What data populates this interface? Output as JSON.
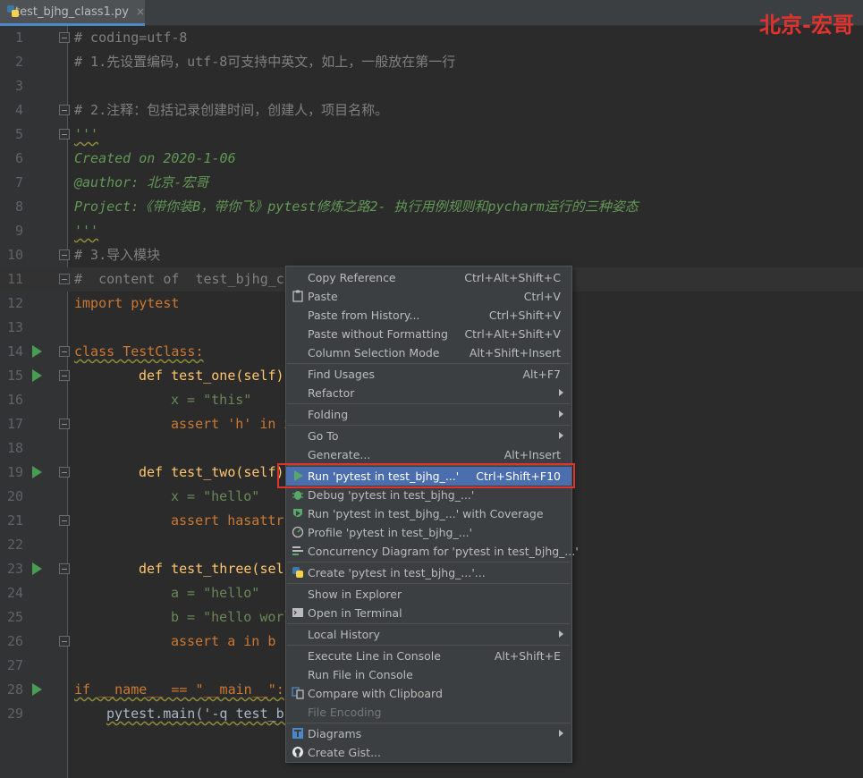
{
  "tab": {
    "filename": "test_bjhg_class1.py",
    "close": "×"
  },
  "watermark": "北京-宏哥",
  "code_lines": [
    {
      "n": "1",
      "text": "# coding=utf-8"
    },
    {
      "n": "2",
      "text": "# 1.先设置编码，utf-8可支持中英文，如上，一般放在第一行"
    },
    {
      "n": "3",
      "text": ""
    },
    {
      "n": "4",
      "text": "# 2.注释：包括记录创建时间，创建人，项目名称。"
    },
    {
      "n": "5",
      "text": "'''"
    },
    {
      "n": "6",
      "text": "Created on 2020-1-06"
    },
    {
      "n": "7",
      "text": "@author: 北京-宏哥"
    },
    {
      "n": "8",
      "text": "Project:《带你装B，带你飞》pytest修炼之路2- 执行用例规则和pycharm运行的三种姿态"
    },
    {
      "n": "9",
      "text": "'''"
    },
    {
      "n": "10",
      "text": "# 3.导入模块"
    },
    {
      "n": "11",
      "text": "#  content of  test_bjhg_c"
    },
    {
      "n": "12",
      "text": "import pytest"
    },
    {
      "n": "13",
      "text": ""
    },
    {
      "n": "14",
      "text": "class TestClass:"
    },
    {
      "n": "15",
      "text": "def test_one(self)"
    },
    {
      "n": "16",
      "text": "x = \"this\""
    },
    {
      "n": "17",
      "text": "assert 'h' in x"
    },
    {
      "n": "18",
      "text": ""
    },
    {
      "n": "19",
      "text": "def test_two(self)"
    },
    {
      "n": "20",
      "text": "x = \"hello\""
    },
    {
      "n": "21",
      "text": "assert hasattr"
    },
    {
      "n": "22",
      "text": ""
    },
    {
      "n": "23",
      "text": "def test_three(self"
    },
    {
      "n": "24",
      "text": "a = \"hello\""
    },
    {
      "n": "25",
      "text": "b = \"hello worl"
    },
    {
      "n": "26",
      "text": "assert a in b"
    },
    {
      "n": "27",
      "text": ""
    },
    {
      "n": "28",
      "text": "if __name__ == \"__main__\":"
    },
    {
      "n": "29",
      "text": "pytest.main('-q test_bj"
    }
  ],
  "menu": {
    "items": [
      {
        "label": "Copy Reference",
        "shortcut": "Ctrl+Alt+Shift+C"
      },
      {
        "label": "Paste",
        "shortcut": "Ctrl+V",
        "icon": "clipboard-icon"
      },
      {
        "label": "Paste from History...",
        "shortcut": "Ctrl+Shift+V"
      },
      {
        "label": "Paste without Formatting",
        "shortcut": "Ctrl+Alt+Shift+V"
      },
      {
        "label": "Column Selection Mode",
        "shortcut": "Alt+Shift+Insert"
      },
      {
        "label": "Find Usages",
        "shortcut": "Alt+F7"
      },
      {
        "label": "Refactor",
        "shortcut": ""
      },
      {
        "label": "Folding",
        "shortcut": ""
      },
      {
        "label": "Go To",
        "shortcut": ""
      },
      {
        "label": "Generate...",
        "shortcut": "Alt+Insert"
      },
      {
        "label": "Run 'pytest in test_bjhg_...'",
        "shortcut": "Ctrl+Shift+F10",
        "icon": "run-icon"
      },
      {
        "label": "Debug 'pytest in test_bjhg_...'",
        "shortcut": "",
        "icon": "debug-icon"
      },
      {
        "label": "Run 'pytest in test_bjhg_...' with Coverage",
        "shortcut": "",
        "icon": "coverage-icon"
      },
      {
        "label": "Profile 'pytest in test_bjhg_...'",
        "shortcut": "",
        "icon": "profile-icon"
      },
      {
        "label": "Concurrency Diagram for 'pytest in test_bjhg_...'",
        "shortcut": "",
        "icon": "concurrency-icon"
      },
      {
        "label": "Create 'pytest in test_bjhg_...'...",
        "shortcut": "",
        "icon": "python-icon"
      },
      {
        "label": "Show in Explorer",
        "shortcut": ""
      },
      {
        "label": "Open in Terminal",
        "shortcut": "",
        "icon": "terminal-icon"
      },
      {
        "label": "Local History",
        "shortcut": ""
      },
      {
        "label": "Execute Line in Console",
        "shortcut": "Alt+Shift+E"
      },
      {
        "label": "Run File in Console",
        "shortcut": ""
      },
      {
        "label": "Compare with Clipboard",
        "shortcut": "",
        "icon": "compare-icon"
      },
      {
        "label": "File Encoding",
        "shortcut": ""
      },
      {
        "label": "Diagrams",
        "shortcut": "",
        "icon": "diagram-icon"
      },
      {
        "label": "Create Gist...",
        "shortcut": "",
        "icon": "github-icon"
      }
    ]
  },
  "colors": {
    "accent": "#4b6eaf",
    "highlight_box": "#e0332e",
    "run_green": "#499c54"
  }
}
